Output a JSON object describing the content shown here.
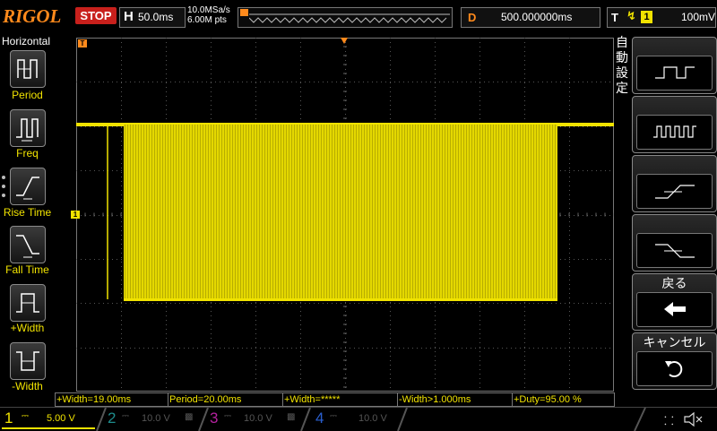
{
  "top": {
    "logo": "RIGOL",
    "run_state": "STOP",
    "timebase_letter": "H",
    "timebase": "50.0ms",
    "sample_rate": "10.0MSa/s",
    "memory_depth": "6.00M pts",
    "delay_letter": "D",
    "delay": "500.000000ms",
    "trigger_letter": "T",
    "trigger_source": "1",
    "trigger_level": "100mV",
    "trigger_edge_icon": "rising-edge-icon"
  },
  "left_panel": {
    "title": "Horizontal",
    "items": [
      {
        "label": "Period",
        "icon": "period-measure-icon"
      },
      {
        "label": "Freq",
        "icon": "frequency-measure-icon"
      },
      {
        "label": "Rise Time",
        "icon": "rise-time-icon"
      },
      {
        "label": "Fall Time",
        "icon": "fall-time-icon"
      },
      {
        "label": "+Width",
        "icon": "positive-width-icon"
      },
      {
        "label": "-Width",
        "icon": "negative-width-icon"
      }
    ]
  },
  "right_panel": {
    "title": "自動設定",
    "buttons": [
      {
        "icon": "single-pulse-icon"
      },
      {
        "icon": "pulse-train-icon"
      },
      {
        "icon": "rising-edge-waveform-icon"
      },
      {
        "icon": "falling-edge-waveform-icon"
      },
      {
        "label": "戻る",
        "icon": "back-arrow-icon"
      },
      {
        "label": "キャンセル",
        "icon": "undo-icon"
      }
    ]
  },
  "measurements": [
    "+Width=19.00ms",
    "Period=20.00ms",
    "+Width=*****",
    "-Width>1.000ms",
    "+Duty=95.00 %"
  ],
  "channels": [
    {
      "num": "1",
      "setting": "5.00 V",
      "color": "#f1e300",
      "active": true
    },
    {
      "num": "2",
      "setting": "10.0 V",
      "color": "#1e8c8c",
      "active": false
    },
    {
      "num": "3",
      "setting": "10.0 V",
      "color": "#b4219e",
      "active": false
    },
    {
      "num": "4",
      "setting": "10.0 V",
      "color": "#2a5fd0",
      "active": false
    }
  ],
  "colors": {
    "trace": "#f1e300",
    "accent": "#ff8a1c",
    "stop": "#c8201c"
  }
}
